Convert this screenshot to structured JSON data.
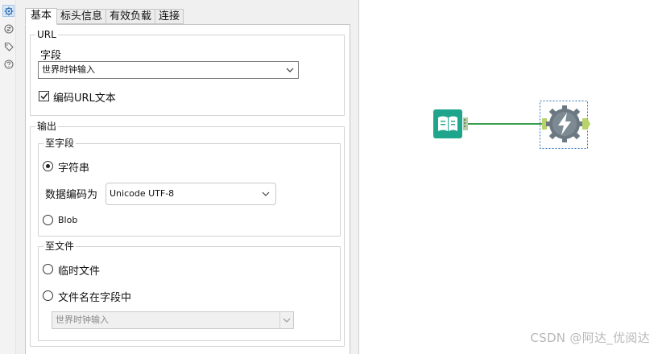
{
  "rail": {
    "icons": [
      "gear-icon",
      "connections-icon",
      "tag-icon",
      "help-icon"
    ]
  },
  "tabs": [
    {
      "label": "基本",
      "active": true
    },
    {
      "label": "标头信息",
      "active": false
    },
    {
      "label": "有效负载",
      "active": false
    },
    {
      "label": "连接",
      "active": false
    }
  ],
  "url_group": {
    "legend": "URL",
    "field_label": "字段",
    "field_value": "世界时钟输入",
    "encode_checkbox": {
      "label": "编码URL文本",
      "checked": true
    }
  },
  "output_group": {
    "legend": "输出",
    "to_field": {
      "legend": "至字段",
      "string_option": {
        "label": "字符串",
        "selected": true
      },
      "encoding_label": "数据编码为",
      "encoding_value": "Unicode UTF-8",
      "blob_option": {
        "label": "Blob",
        "selected": false
      }
    },
    "to_file": {
      "legend": "至文件",
      "temp_file_option": {
        "label": "临时文件",
        "selected": false
      },
      "filename_in_field_option": {
        "label": "文件名在字段中",
        "selected": false
      },
      "filename_field_value": "世界时钟输入"
    }
  },
  "canvas": {
    "nodes": [
      {
        "name": "input-tool-node",
        "icon": "book-icon",
        "color": "#1fa58b"
      },
      {
        "name": "download-tool-node",
        "icon": "lightning-icon",
        "color": "#6b7881",
        "selected": true
      }
    ],
    "connection_color": "#3a9e4f"
  },
  "watermark": "CSDN @阿达_优阅达"
}
